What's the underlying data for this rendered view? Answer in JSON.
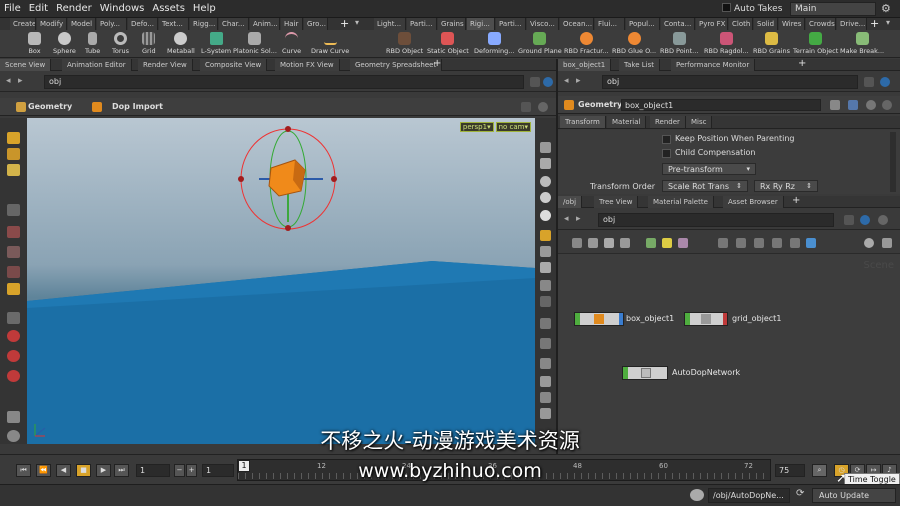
{
  "menu": [
    "File",
    "Edit",
    "Render",
    "Windows",
    "Assets",
    "Help"
  ],
  "auto_takes": "Auto Takes",
  "desktop": "Main",
  "shelf_tabs": [
    "Create",
    "Modify",
    "Model",
    "Poly...",
    "Defo...",
    "Text...",
    "Rigg...",
    "Char...",
    "Anim...",
    "Hair",
    "Gro...",
    "Light...",
    "Parti...",
    "Grains",
    "Rigi...",
    "Parti...",
    "Visco...",
    "Ocean...",
    "Flui...",
    "Popul...",
    "Conta...",
    "Pyro FX",
    "Cloth",
    "Solid",
    "Wires",
    "Crowds",
    "Drive..."
  ],
  "shelf_tools_left": [
    "Box",
    "Sphere",
    "Tube",
    "Torus",
    "Grid",
    "Metaball",
    "L-System",
    "Platonic Sol...",
    "Curve",
    "Draw Curve"
  ],
  "shelf_tools_right": [
    "RBD Object",
    "Static Object",
    "Deforming...",
    "Ground Plane",
    "RBD Fractur...",
    "RBD Glue O...",
    "RBD Point...",
    "RBD Ragdol...",
    "RBD Grains",
    "Terrain Object",
    "Make Break..."
  ],
  "left_pane_tabs": [
    "Scene View",
    "Animation Editor",
    "Render View",
    "Composite View",
    "Motion FX View",
    "Geometry Spreadsheet"
  ],
  "left_path": "obj",
  "viewer_context": "Geometry",
  "viewer_node": "Dop Import",
  "view_tags": [
    "persp1▾",
    "no cam▾"
  ],
  "right_top_tabs": [
    "box_object1",
    "Take List",
    "Performance Monitor"
  ],
  "right_top_path": "obj",
  "param_header_label": "Geometry",
  "param_node_name": "box_object1",
  "param_tabs": [
    "Transform",
    "Material",
    "Render",
    "Misc"
  ],
  "params": {
    "keep_position": "Keep Position When Parenting",
    "child_comp": "Child Compensation",
    "pretransform": "Pre-transform",
    "transform_order_label": "Transform Order",
    "transform_order_value": "Scale Rot Trans",
    "rot_order_value": "Rx Ry Rz"
  },
  "right_bottom_tabs": [
    "/obj",
    "Tree View",
    "Material Palette",
    "Asset Browser"
  ],
  "network_path": "obj",
  "network_context_label": "Scene",
  "nodes": [
    {
      "label": "box_object1",
      "color": "#4fae3f"
    },
    {
      "label": "grid_object1",
      "color": "#4fae3f"
    },
    {
      "label": "AutoDopNetwork",
      "color": "#4fae3f"
    }
  ],
  "timeline": {
    "current_frame": "1",
    "start_frame": "1",
    "playhead_label": "1",
    "ticks": [
      "12",
      "24",
      "36",
      "48",
      "60",
      "72"
    ],
    "end_frame": "75"
  },
  "tooltip": "Time Toggle",
  "status": {
    "path": "/obj/AutoDopNe...",
    "update_mode": "Auto Update"
  },
  "watermark_line1": "不移之火-动漫游戏美术资源",
  "watermark_line2": "www.byzhihuo.com"
}
